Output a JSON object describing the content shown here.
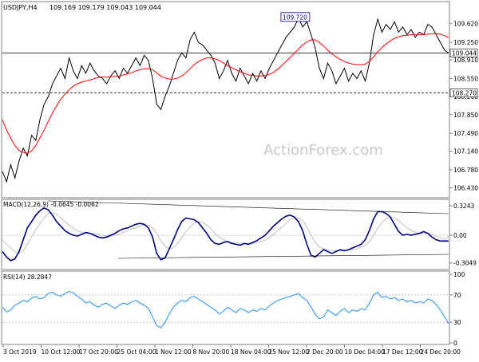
{
  "header": {
    "symbol_tf": "USDJPY,H4",
    "ohlc": "109.169 109.179 109.043 109.044"
  },
  "watermark": "ActionForex.com",
  "colors": {
    "price": "#000000",
    "ma": "#ff0000",
    "macd_main": "#000080",
    "macd_signal": "#c0c0c0",
    "rsi": "#1e90ff",
    "price_tag_bg": "#ffffff"
  },
  "chart_data": [
    {
      "type": "line",
      "panel": "price",
      "title": "USDJPY,H4",
      "ylim": [
        106.3,
        109.98
      ],
      "yticks": [
        "109.620",
        "109.250",
        "108.910",
        "108.550",
        "108.200",
        "107.850",
        "107.490",
        "107.140",
        "106.780",
        "106.430"
      ],
      "tag_current": "109.044",
      "tag_level": "108.270",
      "tag_high": "109.720",
      "levels": [
        109.044,
        108.27
      ],
      "price_series_name": "USDJPY",
      "price": [
        106.75,
        106.55,
        106.88,
        106.62,
        106.95,
        107.2,
        107.05,
        107.45,
        107.35,
        107.75,
        108.05,
        108.2,
        108.45,
        108.6,
        108.75,
        108.55,
        108.95,
        108.7,
        108.55,
        108.8,
        108.65,
        108.85,
        108.7,
        108.6,
        108.55,
        108.45,
        108.6,
        108.7,
        108.55,
        108.75,
        108.65,
        108.8,
        108.95,
        108.8,
        109.0,
        108.9,
        108.55,
        108.05,
        107.95,
        108.2,
        108.4,
        108.65,
        108.9,
        109.05,
        108.95,
        109.3,
        109.45,
        109.25,
        109.2,
        109.1,
        109.0,
        108.85,
        108.55,
        108.7,
        108.9,
        108.65,
        108.5,
        108.75,
        108.6,
        108.45,
        108.65,
        108.5,
        108.7,
        108.55,
        108.75,
        108.9,
        109.05,
        109.2,
        109.35,
        109.45,
        109.55,
        109.72,
        109.55,
        109.65,
        109.4,
        109.15,
        108.75,
        108.55,
        108.85,
        108.7,
        108.45,
        108.6,
        108.75,
        108.5,
        108.65,
        108.55,
        108.7,
        108.5,
        108.85,
        109.4,
        109.7,
        109.45,
        109.6,
        109.5,
        109.65,
        109.45,
        109.55,
        109.4,
        109.5,
        109.35,
        109.45,
        109.4,
        109.6,
        109.55,
        109.4,
        109.25,
        109.1,
        109.044
      ],
      "ma_series_name": "MA",
      "ma": [
        107.75,
        107.55,
        107.4,
        107.25,
        107.15,
        107.12,
        107.1,
        107.15,
        107.25,
        107.4,
        107.55,
        107.72,
        107.88,
        108.02,
        108.15,
        108.25,
        108.33,
        108.4,
        108.45,
        108.48,
        108.5,
        108.52,
        108.55,
        108.57,
        108.58,
        108.58,
        108.58,
        108.59,
        108.6,
        108.62,
        108.64,
        108.66,
        108.7,
        108.72,
        108.74,
        108.74,
        108.72,
        108.66,
        108.6,
        108.56,
        108.54,
        108.54,
        108.56,
        108.6,
        108.66,
        108.74,
        108.82,
        108.88,
        108.92,
        108.95,
        108.95,
        108.93,
        108.9,
        108.85,
        108.8,
        108.76,
        108.72,
        108.68,
        108.65,
        108.62,
        108.61,
        108.6,
        108.6,
        108.61,
        108.63,
        108.67,
        108.73,
        108.8,
        108.88,
        108.96,
        109.04,
        109.12,
        109.2,
        109.26,
        109.3,
        109.3,
        109.25,
        109.18,
        109.1,
        109.03,
        108.97,
        108.92,
        108.88,
        108.85,
        108.83,
        108.82,
        108.82,
        108.83,
        108.88,
        108.97,
        109.07,
        109.15,
        109.22,
        109.28,
        109.33,
        109.36,
        109.38,
        109.39,
        109.4,
        109.4,
        109.4,
        109.4,
        109.41,
        109.42,
        109.42,
        109.41,
        109.38,
        109.35
      ]
    },
    {
      "type": "line",
      "panel": "macd",
      "title": "MACD(12,26,9) -0.0645 -0.0062",
      "ylim": [
        -0.36,
        0.36
      ],
      "yticks": [
        "0.3243",
        "0.00",
        "-0.3049"
      ],
      "main_name": "MACD",
      "main": [
        -0.18,
        -0.24,
        -0.28,
        -0.26,
        -0.18,
        -0.05,
        0.08,
        0.15,
        0.22,
        0.27,
        0.3,
        0.28,
        0.22,
        0.15,
        0.1,
        0.05,
        0.02,
        0.0,
        -0.01,
        0.01,
        0.03,
        0.02,
        0.0,
        -0.02,
        -0.03,
        -0.02,
        0.0,
        0.02,
        0.05,
        0.07,
        0.08,
        0.1,
        0.12,
        0.13,
        0.12,
        0.08,
        -0.02,
        -0.2,
        -0.27,
        -0.25,
        -0.15,
        -0.05,
        0.06,
        0.15,
        0.19,
        0.18,
        0.17,
        0.14,
        0.08,
        0.02,
        -0.05,
        -0.09,
        -0.1,
        -0.08,
        -0.07,
        -0.09,
        -0.1,
        -0.11,
        -0.09,
        -0.1,
        -0.08,
        -0.06,
        -0.03,
        0.0,
        0.05,
        0.1,
        0.14,
        0.18,
        0.21,
        0.22,
        0.2,
        0.15,
        0.05,
        -0.1,
        -0.22,
        -0.24,
        -0.2,
        -0.16,
        -0.18,
        -0.2,
        -0.18,
        -0.16,
        -0.17,
        -0.16,
        -0.14,
        -0.12,
        -0.1,
        -0.05,
        0.05,
        0.18,
        0.26,
        0.26,
        0.24,
        0.2,
        0.12,
        0.04,
        0.0,
        0.01,
        0.0,
        0.01,
        0.02,
        0.04,
        0.02,
        -0.02,
        -0.05,
        -0.0645,
        -0.0645,
        -0.0645
      ],
      "signal_name": "Signal",
      "signal": [
        -0.05,
        -0.1,
        -0.14,
        -0.18,
        -0.2,
        -0.17,
        -0.1,
        -0.02,
        0.06,
        0.13,
        0.19,
        0.24,
        0.25,
        0.23,
        0.19,
        0.15,
        0.11,
        0.08,
        0.05,
        0.03,
        0.02,
        0.02,
        0.02,
        0.01,
        0.0,
        -0.01,
        -0.01,
        0.0,
        0.01,
        0.03,
        0.05,
        0.07,
        0.08,
        0.1,
        0.11,
        0.11,
        0.08,
        0.02,
        -0.06,
        -0.12,
        -0.15,
        -0.14,
        -0.09,
        -0.03,
        0.04,
        0.09,
        0.13,
        0.15,
        0.14,
        0.11,
        0.07,
        0.02,
        -0.02,
        -0.05,
        -0.07,
        -0.08,
        -0.08,
        -0.09,
        -0.09,
        -0.09,
        -0.09,
        -0.08,
        -0.07,
        -0.05,
        -0.03,
        0.01,
        0.05,
        0.09,
        0.13,
        0.17,
        0.19,
        0.19,
        0.16,
        0.09,
        0.0,
        -0.08,
        -0.13,
        -0.15,
        -0.16,
        -0.17,
        -0.17,
        -0.17,
        -0.17,
        -0.16,
        -0.16,
        -0.15,
        -0.13,
        -0.11,
        -0.07,
        0.0,
        0.08,
        0.14,
        0.18,
        0.2,
        0.19,
        0.16,
        0.12,
        0.08,
        0.05,
        0.03,
        0.02,
        0.02,
        0.02,
        0.01,
        -0.01,
        -0.03,
        -0.05,
        -0.0062
      ]
    },
    {
      "type": "line",
      "panel": "rsi",
      "title": "RSI(14) 28.2847",
      "ylim": [
        0,
        100
      ],
      "yticks": [
        "100",
        "70",
        "30",
        "0"
      ],
      "levels": [
        70,
        30
      ],
      "series_name": "RSI",
      "values": [
        52,
        45,
        48,
        55,
        58,
        62,
        60,
        65,
        68,
        64,
        66,
        72,
        74,
        70,
        68,
        72,
        75,
        73,
        68,
        64,
        58,
        60,
        55,
        52,
        56,
        58,
        54,
        50,
        55,
        58,
        56,
        60,
        62,
        58,
        55,
        50,
        38,
        25,
        22,
        30,
        42,
        52,
        58,
        62,
        60,
        66,
        68,
        64,
        60,
        56,
        52,
        48,
        42,
        46,
        52,
        48,
        44,
        50,
        48,
        44,
        48,
        46,
        50,
        48,
        54,
        58,
        62,
        64,
        66,
        68,
        70,
        72,
        66,
        62,
        52,
        42,
        35,
        38,
        48,
        44,
        40,
        46,
        50,
        44,
        48,
        46,
        50,
        48,
        58,
        70,
        74,
        66,
        68,
        64,
        66,
        62,
        64,
        60,
        62,
        58,
        60,
        58,
        64,
        62,
        56,
        48,
        38,
        28.28
      ],
      "x_labels": [
        "3 Oct 2019",
        "10 Oct 12:00",
        "17 Oct 20:00",
        "25 Oct 04:00",
        "1 Nov 12:00",
        "8 Nov 20:00",
        "18 Nov 04:00",
        "25 Nov 12:00",
        "2 Dec 20:00",
        "10 Dec 04:00",
        "17 Dec 12:00",
        "24 Dec 20:00"
      ]
    }
  ]
}
